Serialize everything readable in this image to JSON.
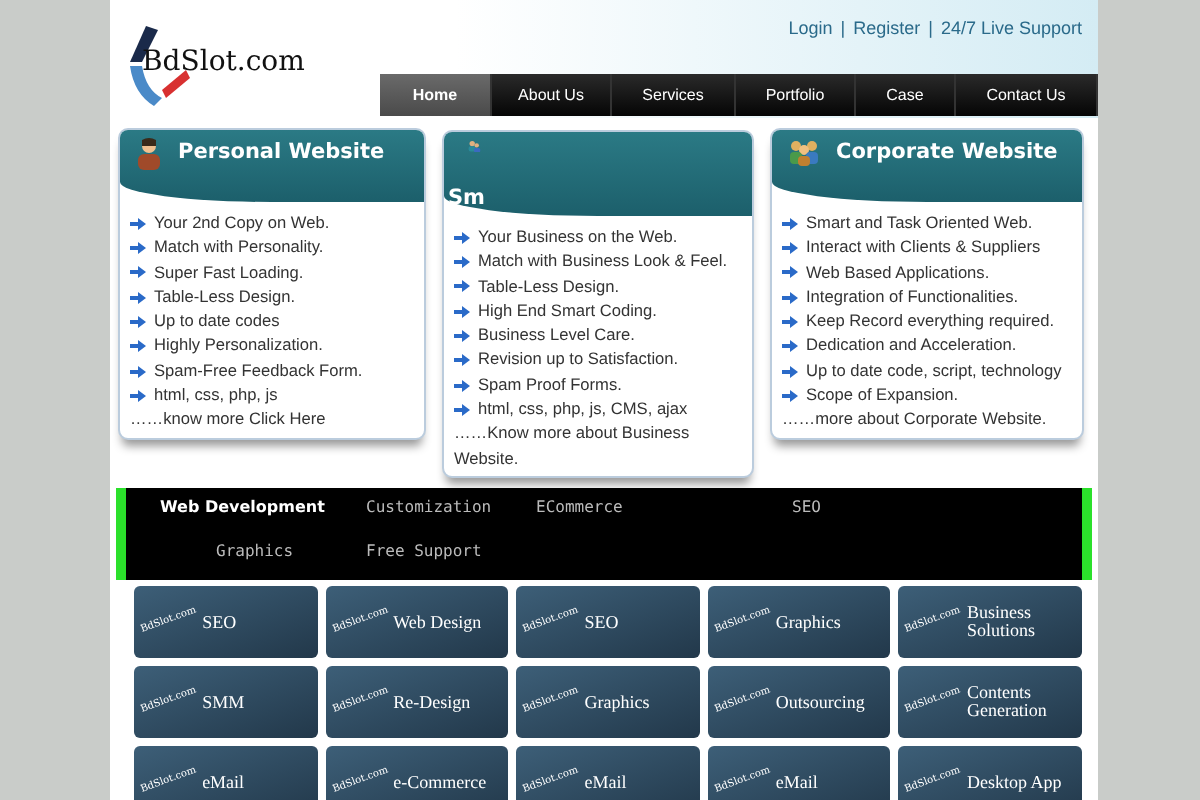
{
  "header": {
    "logo": "BdSlot.com",
    "top_links": [
      "Login",
      "Register",
      "24/7 Live Support"
    ],
    "separators": [
      "|",
      "|"
    ]
  },
  "nav": [
    {
      "label": "Home",
      "selected": true
    },
    {
      "label": "About Us",
      "selected": false
    },
    {
      "label": "Services",
      "selected": false
    },
    {
      "label": "Portfolio",
      "selected": false
    },
    {
      "label": "Case",
      "selected": false
    },
    {
      "label": "Contact Us",
      "selected": false
    }
  ],
  "cards": [
    {
      "title": "Personal Website",
      "items": [
        "Your 2nd Copy on Web.",
        "Match with Personality.",
        "Super Fast Loading.",
        "Table-Less Design.",
        "Up to date codes",
        "Highly Personalization.",
        "Spam-Free Feedback Form.",
        "html, css, php, js"
      ],
      "more": "……know more Click Here"
    },
    {
      "title": "Sm",
      "items": [
        "Your Business on the Web.",
        "Match with Business Look & Feel.",
        "Table-Less Design.",
        "High End Smart Coding.",
        "Business Level Care.",
        "Revision up to Satisfaction.",
        "Spam Proof Forms.",
        "html, css, php, js, CMS, ajax"
      ],
      "more": "……Know more about Business Website."
    },
    {
      "title": "Corporate Website",
      "items": [
        "Smart and Task Oriented Web.",
        "Interact with Clients & Suppliers",
        "Web Based Applications.",
        "Integration of Functionalities.",
        "Keep Record everything required.",
        "Dedication and Acceleration.",
        "Up to date code, script, technology",
        "Scope of Expansion."
      ],
      "more": "……more about Corporate Website."
    }
  ],
  "service_tabs": [
    {
      "label": "Web Development",
      "selected": true
    },
    {
      "label": "Customization",
      "selected": false
    },
    {
      "label": "ECommerce",
      "selected": false
    },
    {
      "label": "SEO",
      "selected": false
    },
    {
      "label": "Graphics",
      "selected": false
    },
    {
      "label": "Free Support",
      "selected": false
    }
  ],
  "tiles": [
    {
      "side": "BdSlot.com",
      "label": "SEO"
    },
    {
      "side": "BdSlot.com",
      "label": "Web Design"
    },
    {
      "side": "BdSlot.com",
      "label": "SEO"
    },
    {
      "side": "BdSlot.com",
      "label": "Graphics"
    },
    {
      "side": "BdSlot.com",
      "label": "Business Solutions"
    },
    {
      "side": "BdSlot.com",
      "label": "SMM"
    },
    {
      "side": "BdSlot.com",
      "label": "Re-Design"
    },
    {
      "side": "BdSlot.com",
      "label": "Graphics"
    },
    {
      "side": "BdSlot.com",
      "label": "Outsourcing"
    },
    {
      "side": "BdSlot.com",
      "label": "Contents Generation"
    },
    {
      "side": "BdSlot.com",
      "label": "eMail"
    },
    {
      "side": "BdSlot.com",
      "label": "e-Commerce"
    },
    {
      "side": "BdSlot.com",
      "label": "eMail"
    },
    {
      "side": "BdSlot.com",
      "label": "eMail"
    },
    {
      "side": "BdSlot.com",
      "label": "Desktop App"
    }
  ]
}
